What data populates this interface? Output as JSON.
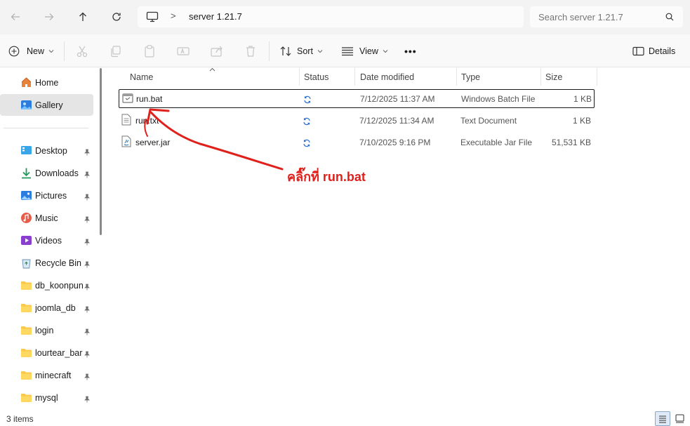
{
  "nav": {
    "back_icon": "arrow-left-icon",
    "forward_icon": "arrow-right-icon",
    "up_icon": "arrow-up-icon",
    "refresh_icon": "refresh-icon"
  },
  "address": {
    "computer_icon": "monitor-icon",
    "chevron": ">",
    "path": "server 1.21.7"
  },
  "search": {
    "placeholder": "Search server 1.21.7"
  },
  "toolbar": {
    "new_label": "New",
    "sort_label": "Sort",
    "view_label": "View",
    "more_label": "•••",
    "details_label": "Details"
  },
  "sidebar": {
    "top_items": [
      {
        "label": "Home",
        "icon": "home-icon"
      },
      {
        "label": "Gallery",
        "icon": "gallery-icon",
        "selected": true
      }
    ],
    "pinned_items": [
      {
        "label": "Desktop",
        "icon": "desktop-icon"
      },
      {
        "label": "Downloads",
        "icon": "download-icon"
      },
      {
        "label": "Pictures",
        "icon": "pictures-icon"
      },
      {
        "label": "Music",
        "icon": "music-icon"
      },
      {
        "label": "Videos",
        "icon": "videos-icon"
      },
      {
        "label": "Recycle Bin",
        "icon": "recycle-bin-icon"
      },
      {
        "label": "db_koonpun",
        "icon": "folder-icon"
      },
      {
        "label": "joomla_db",
        "icon": "folder-icon"
      },
      {
        "label": "login",
        "icon": "folder-icon"
      },
      {
        "label": "lourtear_barbershop",
        "icon": "folder-icon"
      },
      {
        "label": "minecraft",
        "icon": "folder-icon"
      },
      {
        "label": "mysql",
        "icon": "folder-icon"
      }
    ]
  },
  "columns": {
    "name": "Name",
    "status": "Status",
    "date": "Date modified",
    "type": "Type",
    "size": "Size"
  },
  "files": [
    {
      "name": "run.bat",
      "date": "7/12/2025 11:37 AM",
      "type": "Windows Batch File",
      "size": "1 KB",
      "icon": "batch-file-icon",
      "selected": true
    },
    {
      "name": "run.txt",
      "date": "7/12/2025 11:34 AM",
      "type": "Text Document",
      "size": "1 KB",
      "icon": "text-file-icon"
    },
    {
      "name": "server.jar",
      "date": "7/10/2025 9:16 PM",
      "type": "Executable Jar File",
      "size": "51,531 KB",
      "icon": "jar-file-icon"
    }
  ],
  "annotation": {
    "text": "คลิ๊กที่ run.bat",
    "color": "#e0201b"
  },
  "status": {
    "item_count": "3 items"
  },
  "colors": {
    "accent": "#0067c0",
    "sync": "#2a6fcf",
    "folder": "#f8c94a"
  }
}
